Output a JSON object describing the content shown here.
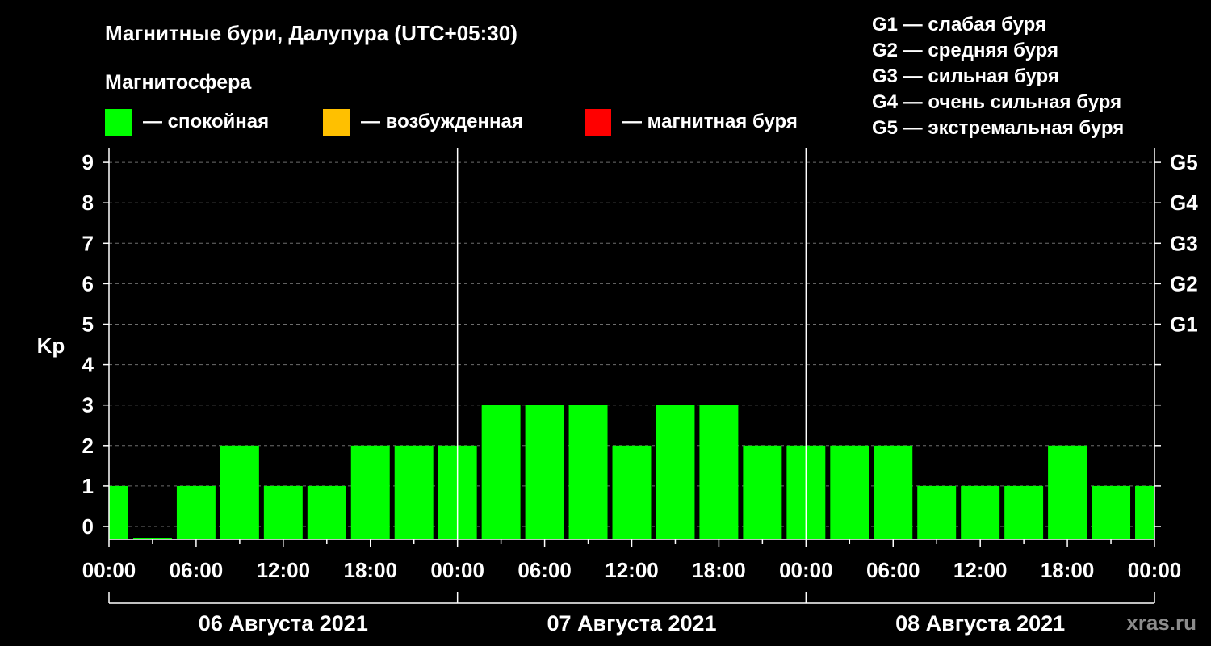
{
  "chart_data": {
    "type": "bar",
    "title": "Магнитные бури, Далупура (UTC+05:30)",
    "legend_title": "Магнитосфера",
    "legend": [
      {
        "label": "— спокойная",
        "color": "#00ff00"
      },
      {
        "label": "— возбужденная",
        "color": "#ffc000"
      },
      {
        "label": "— магнитная буря",
        "color": "#ff0000"
      }
    ],
    "storm_levels": [
      {
        "text": "G1 — слабая буря"
      },
      {
        "text": "G2 — средняя буря"
      },
      {
        "text": "G3 — сильная буря"
      },
      {
        "text": "G4 — очень сильная буря"
      },
      {
        "text": "G5 — экстремальная буря"
      }
    ],
    "ylabel": "Kp",
    "ylim": [
      0,
      9
    ],
    "yticks": [
      "0",
      "1",
      "2",
      "3",
      "4",
      "5",
      "6",
      "7",
      "8",
      "9"
    ],
    "g_scale": [
      {
        "label": "G1",
        "kp": 5
      },
      {
        "label": "G2",
        "kp": 6
      },
      {
        "label": "G3",
        "kp": 7
      },
      {
        "label": "G4",
        "kp": 8
      },
      {
        "label": "G5",
        "kp": 9
      }
    ],
    "xtick_labels": [
      "00:00",
      "06:00",
      "12:00",
      "18:00",
      "00:00",
      "06:00",
      "12:00",
      "18:00",
      "00:00",
      "06:00",
      "12:00",
      "18:00",
      "00:00"
    ],
    "days": [
      "06 Августа 2021",
      "07 Августа 2021",
      "08 Августа 2021"
    ],
    "x_range_hours": [
      0,
      72
    ],
    "interval_hours": 3,
    "first_interval_start_hours": -1.5,
    "values": [
      1,
      0,
      1,
      2,
      1,
      1,
      2,
      2,
      2,
      3,
      3,
      3,
      2,
      3,
      3,
      2,
      2,
      2,
      2,
      1,
      1,
      1,
      2,
      1,
      1
    ],
    "bar_color": "#00ff00",
    "grid": true
  },
  "watermark": "xras.ru"
}
